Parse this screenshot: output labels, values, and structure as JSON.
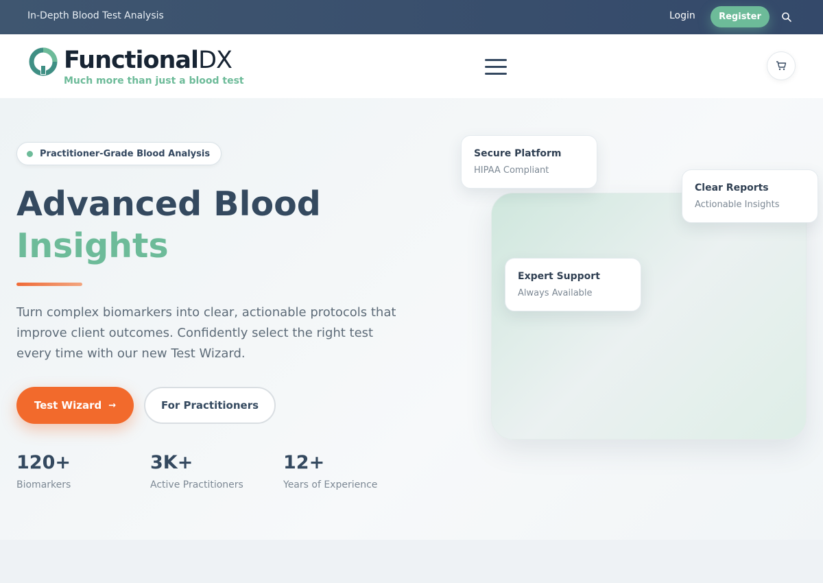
{
  "topbar": {
    "tagline": "In-Depth Blood Test Analysis",
    "login": "Login",
    "register": "Register"
  },
  "header": {
    "logo_main": "Functional",
    "logo_dx": "DX",
    "logo_sub": "Much more than just a blood test"
  },
  "hero": {
    "badge": "Practitioner-Grade Blood Analysis",
    "title_line1": "Advanced Blood",
    "title_line2": "Insights",
    "lead": "Turn complex biomarkers into clear, actionable protocols that improve client outcomes. Confidently select the right test every time with our new Test Wizard.",
    "cta_primary": "Test Wizard",
    "cta_primary_arrow": "→",
    "cta_secondary": "For Practitioners",
    "stats": [
      {
        "num": "120+",
        "label": "Biomarkers"
      },
      {
        "num": "3K+",
        "label": "Active Practitioners"
      },
      {
        "num": "12+",
        "label": "Years of Experience"
      }
    ]
  },
  "panel": {
    "cards": [
      {
        "title": "Secure Platform",
        "sub": "HIPAA Compliant"
      },
      {
        "title": "Clear Reports",
        "sub": "Actionable Insights"
      },
      {
        "title": "Expert Support",
        "sub": "Always Available"
      }
    ]
  },
  "colors": {
    "brand_green": "#6dbb99",
    "brand_orange": "#f26a2c",
    "navy": "#34495f"
  },
  "icons": {
    "search": "search-icon",
    "cart": "cart-icon",
    "menu": "hamburger-menu-icon",
    "logo": "logo-mark-icon"
  }
}
